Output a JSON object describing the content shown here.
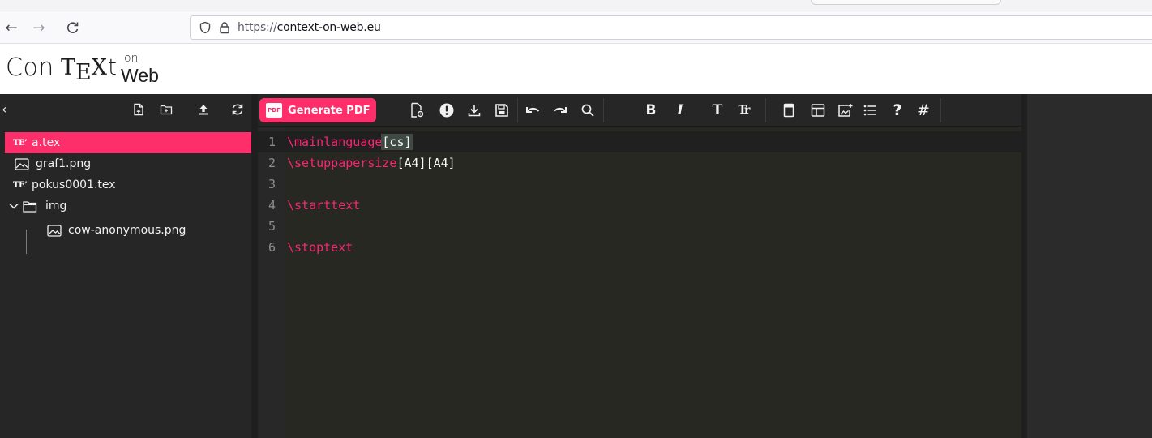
{
  "browser": {
    "url_scheme": "https://",
    "url_host": "context-on-web.eu",
    "back_glyph": "←",
    "forward_glyph": "→",
    "reload_glyph": "C"
  },
  "logo": {
    "con": "Con",
    "t": "T",
    "e": "E",
    "x": "X",
    "t2": "t",
    "on": "on",
    "web": "Web"
  },
  "sidebar": {
    "collapse_glyph": "‹",
    "items": [
      {
        "label": "a.tex",
        "type": "tex",
        "active": true,
        "nested": false
      },
      {
        "label": "graf1.png",
        "type": "image",
        "active": false,
        "nested": false
      },
      {
        "label": "pokus0001.tex",
        "type": "tex",
        "active": false,
        "nested": false
      },
      {
        "label": "img",
        "type": "folder-open",
        "active": false,
        "nested": false
      },
      {
        "label": "cow-anonymous.png",
        "type": "image",
        "active": false,
        "nested": true
      }
    ],
    "tex_mark": "TE᠌X"
  },
  "toolbar": {
    "generate_label": "Generate PDF",
    "pdf_badge": "PDF",
    "bold": "B",
    "italic": "I",
    "typewriter": "T",
    "smallcaps": "Tr",
    "help": "?",
    "hash": "#"
  },
  "editor": {
    "lines": [
      {
        "num": "1",
        "cmd": "\\mainlanguage",
        "args": "[cs]"
      },
      {
        "num": "2",
        "cmd": "\\setuppapersize",
        "args": "[A4][A4]"
      },
      {
        "num": "3",
        "cmd": "",
        "args": ""
      },
      {
        "num": "4",
        "cmd": "\\starttext",
        "args": ""
      },
      {
        "num": "5",
        "cmd": "",
        "args": ""
      },
      {
        "num": "6",
        "cmd": "\\stoptext",
        "args": ""
      }
    ]
  },
  "colors": {
    "accent": "#fd2e6a",
    "editor_bg": "#272822",
    "keyword": "#f92672"
  }
}
